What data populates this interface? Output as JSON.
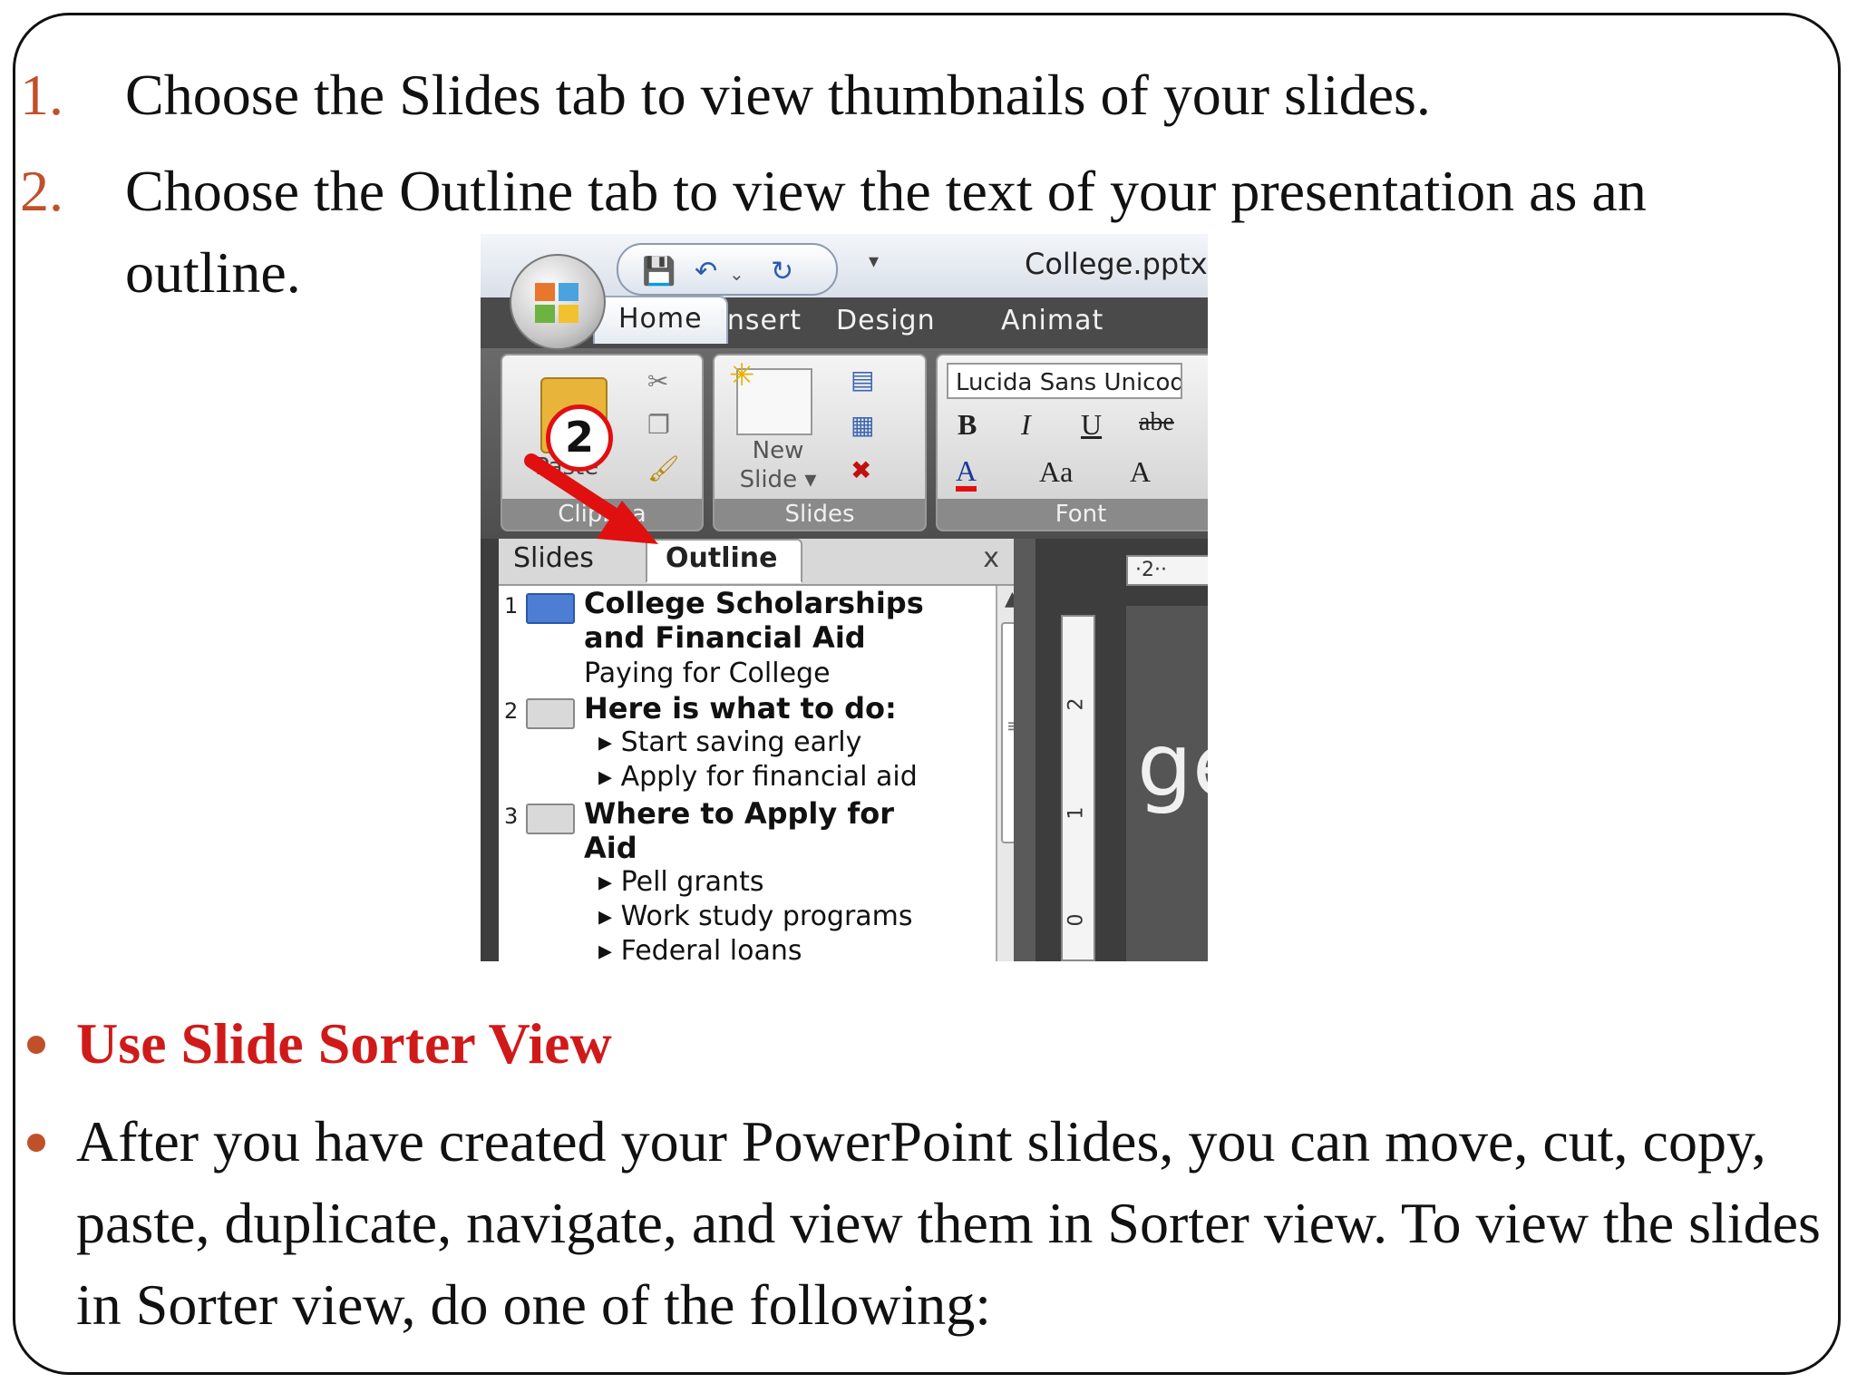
{
  "steps": [
    {
      "number": "1.",
      "text": "Choose the Slides tab to view thumbnails of your slides."
    },
    {
      "number": "2.",
      "text": "Choose the Outline tab to view the text of your presentation as an outline."
    }
  ],
  "bullets": [
    {
      "text": "Use Slide Sorter View",
      "style": "heading"
    },
    {
      "text": "After you have created your PowerPoint slides, you can move, cut, copy, paste, duplicate, navigate, and view them in Sorter view. To view the slides in Sorter view, do one of the following:"
    }
  ],
  "colors": {
    "accent": "#c0502a",
    "heading_red": "#d01a1a"
  },
  "screenshot": {
    "file_title": "College.pptx",
    "ribbon_tabs": [
      "Home",
      "Insert",
      "Design",
      "Animat"
    ],
    "active_tab": "Home",
    "groups": {
      "clipboard": "Clipboa",
      "slides": "Slides",
      "font": "Font"
    },
    "paste_label": "Paste",
    "callout_number": "2",
    "new_slide_label_1": "New",
    "new_slide_label_2": "Slide ▾",
    "font_name": "Lucida Sans Unicode",
    "font_buttons": [
      "B",
      "I",
      "U",
      "abe"
    ],
    "font_buttons_2": [
      "A",
      "Aa",
      "A"
    ],
    "pane_tabs": {
      "slides": "Slides",
      "outline": "Outline",
      "close": "x"
    },
    "ruler_h": "·2··",
    "ruler_v": [
      "2",
      "1",
      "0"
    ],
    "slide_fragment": "ge",
    "outline": {
      "s1_num": "1",
      "s1_title_1": "College Scholarships",
      "s1_title_2": "and Financial Aid",
      "s1_sub": "Paying for College",
      "s2_num": "2",
      "s2_title": "Here is what to do:",
      "s2_bullets": [
        "Start saving early",
        "Apply for financial aid"
      ],
      "s3_num": "3",
      "s3_title_1": "Where to Apply for",
      "s3_title_2": "Aid",
      "s3_bullets": [
        "Pell grants",
        "Work study programs",
        "Federal loans"
      ]
    },
    "icons": [
      "office-button-icon",
      "save-icon",
      "undo-icon",
      "redo-icon",
      "cut-icon",
      "copy-icon",
      "format-painter-icon",
      "layout-icon",
      "reset-icon",
      "delete-icon",
      "red-arrow-icon"
    ]
  }
}
